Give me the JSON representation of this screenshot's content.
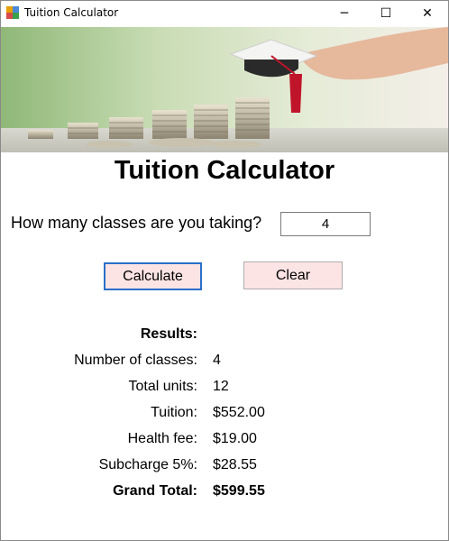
{
  "window": {
    "title": "Tuition Calculator",
    "minimize_glyph": "─",
    "maximize_glyph": "☐",
    "close_glyph": "✕"
  },
  "main": {
    "heading": "Tuition Calculator",
    "question": "How many classes are you taking?",
    "classes_value": "4",
    "calculate_label": "Calculate",
    "clear_label": "Clear"
  },
  "results": {
    "header": "Results:",
    "rows": [
      {
        "label": "Number of classes:",
        "value": "4"
      },
      {
        "label": "Total units:",
        "value": "12"
      },
      {
        "label": "Tuition:",
        "value": "$552.00"
      },
      {
        "label": "Health fee:",
        "value": "$19.00"
      },
      {
        "label": "Subcharge 5%:",
        "value": "$28.55"
      },
      {
        "label": "Grand Total:",
        "value": "$599.55"
      }
    ]
  },
  "icons": [
    "app-icon",
    "minimize-icon",
    "maximize-icon",
    "close-icon",
    "graduation-cap-icon",
    "coin-stacks-icon"
  ],
  "colors": {
    "button_bg": "#fde4e4",
    "focus_border": "#2a6fc9",
    "banner_green": "#9dbf7f"
  }
}
